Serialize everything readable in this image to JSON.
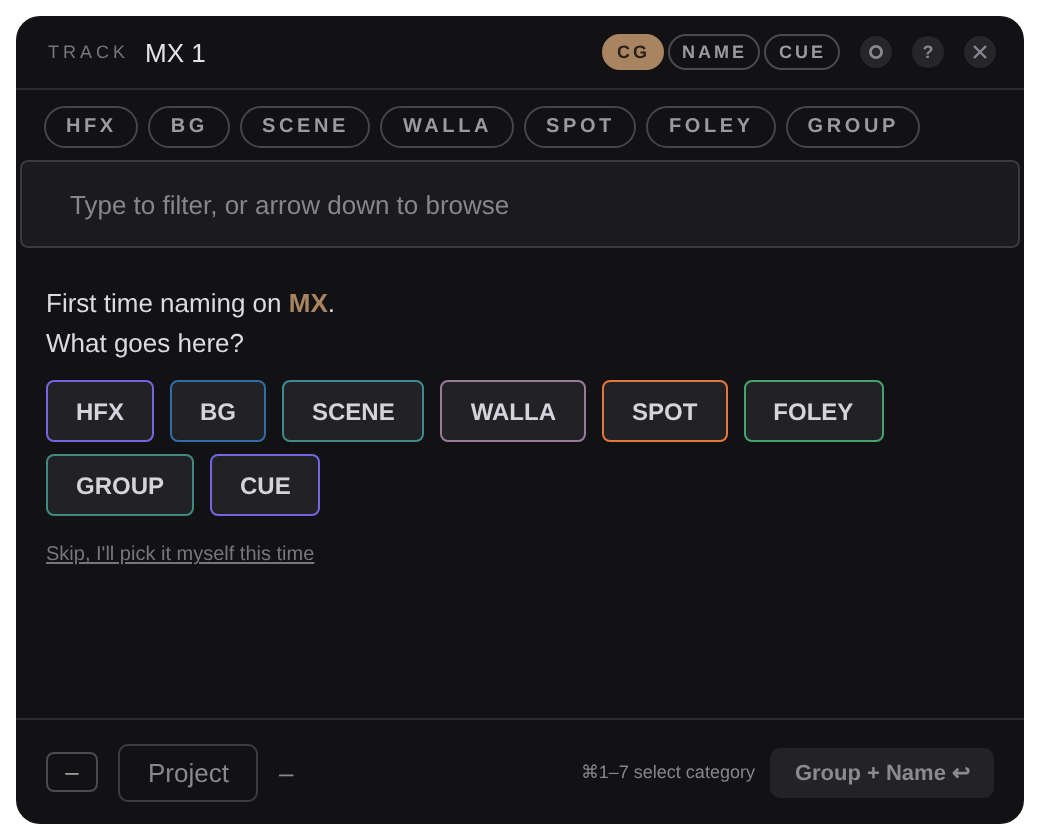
{
  "header": {
    "label": "TRACK",
    "track": "MX 1",
    "modes": [
      {
        "label": "CG",
        "selected": true
      },
      {
        "label": "NAME",
        "selected": false
      },
      {
        "label": "CUE",
        "selected": false
      }
    ],
    "help": "?"
  },
  "chips": [
    "HFX",
    "BG",
    "SCENE",
    "WALLA",
    "SPOT",
    "FOLEY",
    "GROUP"
  ],
  "filter": {
    "placeholder": "Type to filter, or arrow down to browse"
  },
  "prompt": [
    "First time naming on **MX**.",
    "What goes here?"
  ],
  "categories": [
    {
      "label": "HFX",
      "color": "#7366e0"
    },
    {
      "label": "BG",
      "color": "#2f6ea8"
    },
    {
      "label": "SCENE",
      "color": "#3f8a8c"
    },
    {
      "label": "WALLA",
      "color": "#9a7a98"
    },
    {
      "label": "SPOT",
      "color": "#e4783a"
    },
    {
      "label": "FOLEY",
      "color": "#44a56a"
    },
    {
      "label": "GROUP",
      "color": "#3f8a80"
    },
    {
      "label": "CUE",
      "color": "#7366e0"
    }
  ],
  "skip_link": "Skip, I'll pick it myself this time",
  "footer": {
    "minus": "–",
    "project": "Project",
    "dash": "–",
    "hint": "⌘1–7 select category",
    "confirm": "Group + Name ↩"
  }
}
